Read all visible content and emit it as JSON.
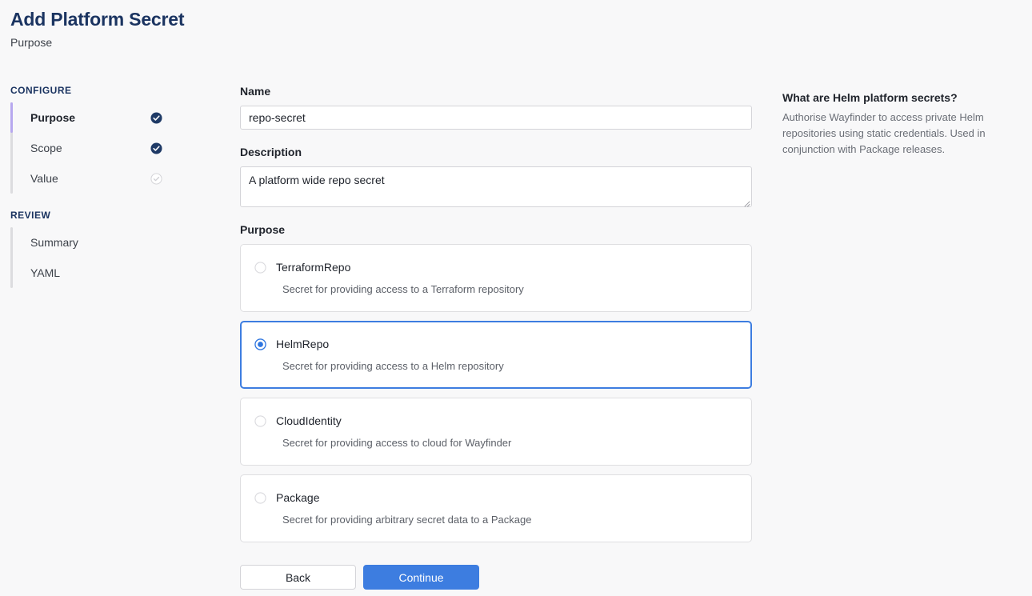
{
  "header": {
    "title": "Add Platform Secret",
    "subtitle": "Purpose"
  },
  "sidebar": {
    "groups": [
      {
        "title": "CONFIGURE",
        "items": [
          {
            "label": "Purpose",
            "state": "complete",
            "active": true
          },
          {
            "label": "Scope",
            "state": "complete",
            "active": false
          },
          {
            "label": "Value",
            "state": "pending",
            "active": false
          }
        ]
      },
      {
        "title": "REVIEW",
        "items": [
          {
            "label": "Summary",
            "state": "none",
            "active": false
          },
          {
            "label": "YAML",
            "state": "none",
            "active": false
          }
        ]
      }
    ]
  },
  "form": {
    "name": {
      "label": "Name",
      "value": "repo-secret",
      "placeholder": ""
    },
    "description": {
      "label": "Description",
      "value": "A platform wide repo secret",
      "placeholder": ""
    },
    "purpose": {
      "label": "Purpose",
      "selected": "HelmRepo",
      "options": [
        {
          "name": "TerraformRepo",
          "description": "Secret for providing access to a Terraform repository",
          "selected": false
        },
        {
          "name": "HelmRepo",
          "description": "Secret for providing access to a Helm repository",
          "selected": true
        },
        {
          "name": "CloudIdentity",
          "description": "Secret for providing access to cloud for Wayfinder",
          "selected": false
        },
        {
          "name": "Package",
          "description": "Secret for providing arbitrary secret data to a Package",
          "selected": false
        }
      ]
    }
  },
  "actions": {
    "back_label": "Back",
    "continue_label": "Continue"
  },
  "help": {
    "title": "What are Helm platform secrets?",
    "body": "Authorise Wayfinder to access private Helm repositories using static credentials. Used in conjunction with Package releases."
  },
  "colors": {
    "title_navy": "#1b3461",
    "accent_blue": "#3d7de0",
    "step_active_rail": "#b7a8ef",
    "step_complete": "#1f3a66",
    "background": "#f8f8f9"
  },
  "icons": {
    "step_complete": "check-circle-filled-icon",
    "step_pending": "check-circle-outline-icon",
    "radio_selected": "radio-selected-icon",
    "radio_unselected": "radio-unselected-icon",
    "resize": "resize-handle-icon"
  }
}
